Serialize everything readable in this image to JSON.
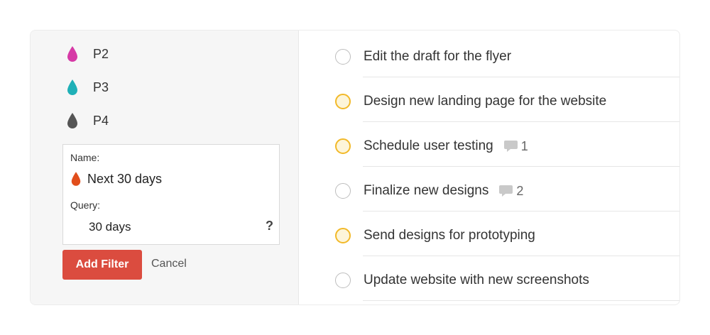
{
  "colors": {
    "p2": "#d63aa6",
    "p3": "#1fb0b7",
    "p4": "#555555",
    "filter_drop": "#e14e1c",
    "accent": "#db4c3f",
    "priority3_ring": "#f2b929"
  },
  "sidebar": {
    "priorities": [
      {
        "label": "P2",
        "icon": "drop-icon"
      },
      {
        "label": "P3",
        "icon": "drop-icon"
      },
      {
        "label": "P4",
        "icon": "drop-icon"
      }
    ]
  },
  "filter_form": {
    "name_label": "Name:",
    "name_value": "Next 30 days",
    "query_label": "Query:",
    "query_value": "30 days",
    "help_label": "?",
    "add_label": "Add Filter",
    "cancel_label": "Cancel"
  },
  "tasks": [
    {
      "title": "Edit the draft for the flyer",
      "priority": "p4",
      "comments": ""
    },
    {
      "title": "Design new landing page for the website",
      "priority": "p3",
      "comments": ""
    },
    {
      "title": "Schedule user testing",
      "priority": "p3",
      "comments": "1"
    },
    {
      "title": "Finalize new designs",
      "priority": "p4",
      "comments": "2"
    },
    {
      "title": "Send designs for prototyping",
      "priority": "p3",
      "comments": ""
    },
    {
      "title": "Update website with new screenshots",
      "priority": "p4",
      "comments": ""
    }
  ]
}
